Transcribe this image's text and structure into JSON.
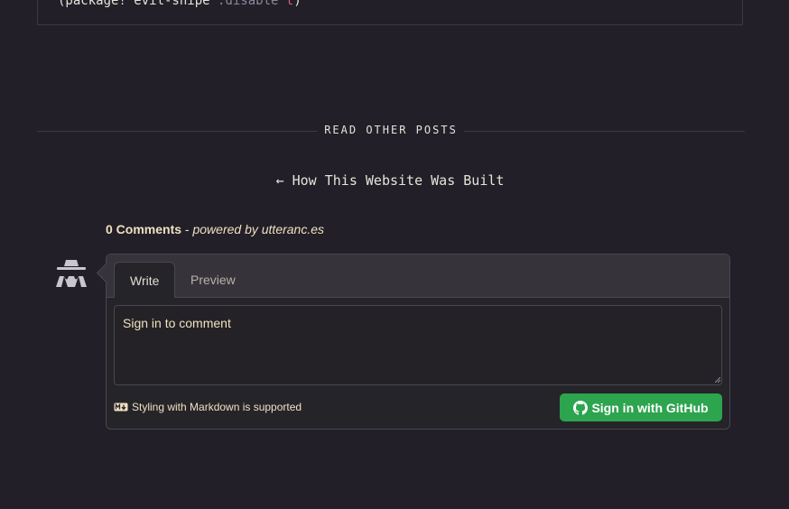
{
  "code": {
    "prefix": "(package! evil-snipe ",
    "keyword": ":disable",
    "value": " t",
    "suffix": ")"
  },
  "divider": {
    "label": "READ OTHER POSTS"
  },
  "prev_post": {
    "arrow": "←",
    "title": "How This Website Was Built"
  },
  "comments": {
    "count_label": "0 Comments",
    "separator": " - ",
    "powered_by": "powered by utteranc.es",
    "tabs": [
      {
        "label": "Write"
      },
      {
        "label": "Preview"
      }
    ],
    "textarea_placeholder": "Sign in to comment",
    "markdown_note": "Styling with Markdown is supported",
    "signin_label": "Sign in with GitHub"
  },
  "colors": {
    "background": "#221f29",
    "button_green": "#2da44e",
    "accent_text": "#efe1bf"
  }
}
